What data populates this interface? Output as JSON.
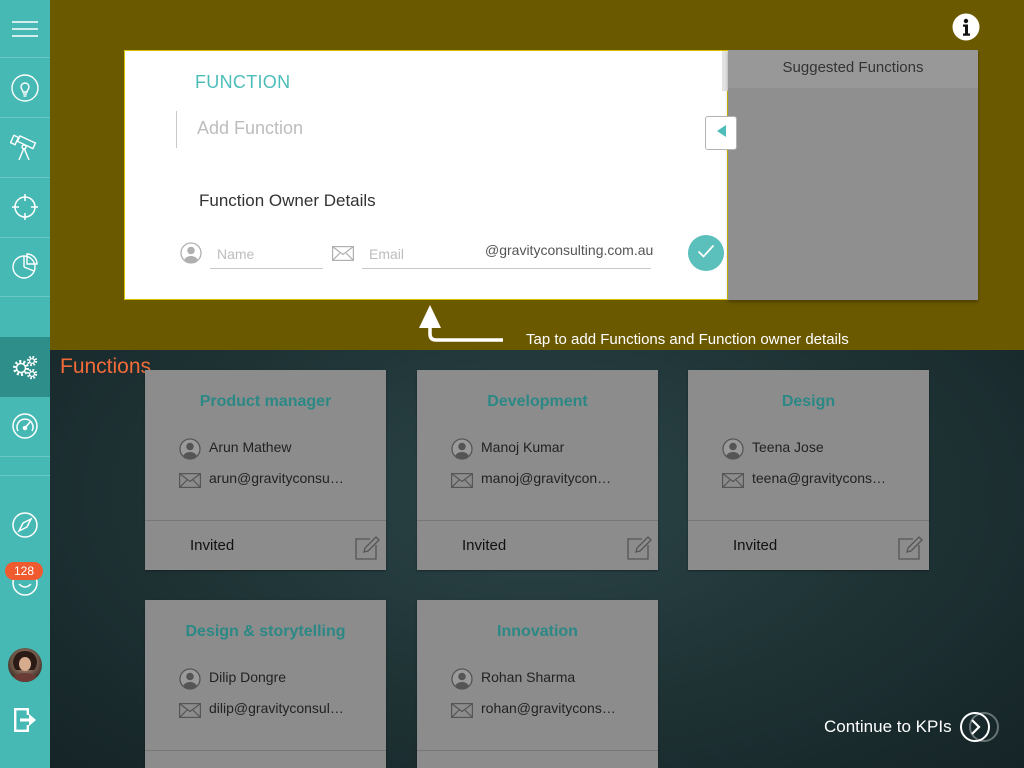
{
  "sidebar": {
    "items": [
      {
        "icon": "menu-icon"
      },
      {
        "icon": "lightbulb-icon"
      },
      {
        "icon": "telescope-icon"
      },
      {
        "icon": "crosshair-icon"
      },
      {
        "icon": "pie-chart-icon"
      },
      {
        "icon": "gears-icon",
        "selected": true
      },
      {
        "icon": "speedometer-icon"
      },
      {
        "icon": "compass-icon"
      },
      {
        "icon": "smiley-icon"
      },
      {
        "icon": "avatar"
      },
      {
        "icon": "logout-icon"
      }
    ],
    "notification_badge": "128"
  },
  "header": {
    "info_icon": "info-icon"
  },
  "function_form": {
    "title": "FUNCTION",
    "function_placeholder": "Add Function",
    "owner_heading": "Function Owner Details",
    "name_placeholder": "Name",
    "email_placeholder": "Email",
    "email_domain": "@gravityconsulting.com.au",
    "submit_icon": "checkmark-icon",
    "collapse_icon": "triangle-left-icon"
  },
  "suggested_functions": {
    "title": "Suggested Functions"
  },
  "coach_mark": {
    "text": "Tap to add Functions and Function owner details"
  },
  "section_title": "Functions",
  "cards": [
    {
      "title": "Product manager",
      "owner": "Arun Mathew",
      "email": "arun@gravityconsu…",
      "status": "Invited"
    },
    {
      "title": "Development",
      "owner": "Manoj Kumar",
      "email": "manoj@gravitycon…",
      "status": "Invited"
    },
    {
      "title": "Design",
      "owner": "Teena Jose",
      "email": "teena@gravitycons…",
      "status": "Invited"
    },
    {
      "title": "Design & storytelling",
      "owner": "Dilip Dongre",
      "email": "dilip@gravityconsul…"
    },
    {
      "title": "Innovation",
      "owner": "Rohan Sharma",
      "email": "rohan@gravitycons…"
    }
  ],
  "footer": {
    "continue_label": "Continue to KPIs"
  },
  "colors": {
    "sidebar": "#47b9b5",
    "sidebar_selected": "#2d8e8a",
    "accent_teal": "#4dbdb9",
    "section_title": "#f26b38",
    "badge": "#ef5a2f",
    "overlay_top": "#6b5900",
    "card_title": "#2b8885"
  }
}
